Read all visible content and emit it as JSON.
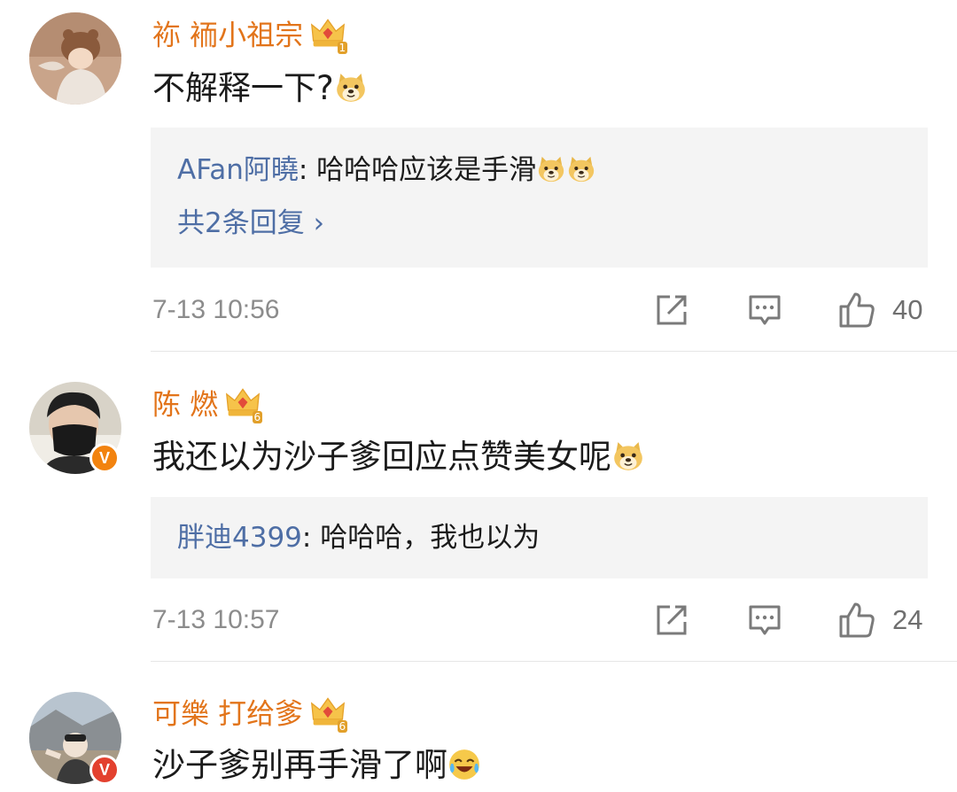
{
  "comments": [
    {
      "username": "袮  袻小祖宗",
      "crown_level": "1",
      "text": "不解释一下?",
      "text_emoji": "doge",
      "reply": {
        "user": "AFan阿曉",
        "separator": ": ",
        "text": "哈哈哈应该是手滑",
        "emojis": [
          "doge",
          "doge"
        ],
        "more": "共2条回复 ›"
      },
      "time": "7-13 10:56",
      "likes": "40"
    },
    {
      "username": "陈  燃",
      "crown_level": "6",
      "verified": "V",
      "text": "我还以为沙子爹回应点赞美女呢",
      "text_emoji": "doge",
      "reply": {
        "user": "胖迪4399",
        "separator": ": ",
        "text": "哈哈哈，我也以为"
      },
      "time": "7-13 10:57",
      "likes": "24"
    },
    {
      "username": "可樂    打给爹",
      "crown_level": "6",
      "verified": "V",
      "text": "沙子爹别再手滑了啊",
      "text_emoji": "laugh-cry"
    }
  ],
  "icons": {
    "share": "share-icon",
    "comment": "comment-icon",
    "like": "thumbs-up-icon"
  },
  "colors": {
    "username": "#e2741a",
    "reply_user": "#4e6ea5",
    "meta": "#8c8c8c",
    "reply_bg": "#f4f4f4"
  }
}
